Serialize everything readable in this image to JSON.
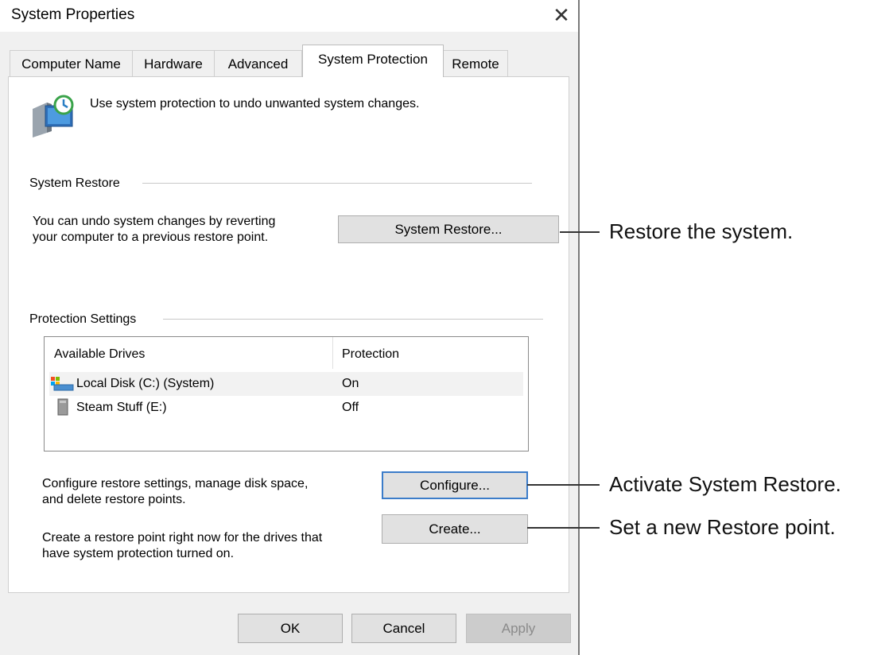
{
  "window": {
    "title": "System Properties",
    "close_glyph": "✕"
  },
  "tabs": [
    {
      "label": "Computer Name"
    },
    {
      "label": "Hardware"
    },
    {
      "label": "Advanced"
    },
    {
      "label": "System Protection"
    },
    {
      "label": "Remote"
    }
  ],
  "header": {
    "text": "Use system protection to undo unwanted system changes.",
    "icon": "system-protection-icon"
  },
  "system_restore": {
    "group_label": "System Restore",
    "description_line1": "You can undo system changes by reverting",
    "description_line2": "your computer to a previous restore point.",
    "button_label": "System Restore..."
  },
  "protection_settings": {
    "group_label": "Protection Settings",
    "columns": [
      "Available Drives",
      "Protection"
    ],
    "drives": [
      {
        "name": "Local Disk (C:) (System)",
        "protection": "On",
        "icon": "system-drive-icon"
      },
      {
        "name": "Steam Stuff (E:)",
        "protection": "Off",
        "icon": "drive-icon"
      }
    ],
    "configure": {
      "description_line1": "Configure restore settings, manage disk space,",
      "description_line2": "and delete restore points.",
      "button_label": "Configure..."
    },
    "create": {
      "description_line1": "Create a restore point right now for the drives that",
      "description_line2": "have system protection turned on.",
      "button_label": "Create..."
    }
  },
  "footer": {
    "ok": "OK",
    "cancel": "Cancel",
    "apply": "Apply"
  },
  "callouts": {
    "restore": "Restore the system.",
    "configure": "Activate System Restore.",
    "create": "Set a new Restore point."
  },
  "colors": {
    "dialog_bg": "#f0f0f0",
    "panel_bg": "#ffffff",
    "focus_border": "#3b7cc9",
    "button_bg": "#e1e1e1"
  }
}
